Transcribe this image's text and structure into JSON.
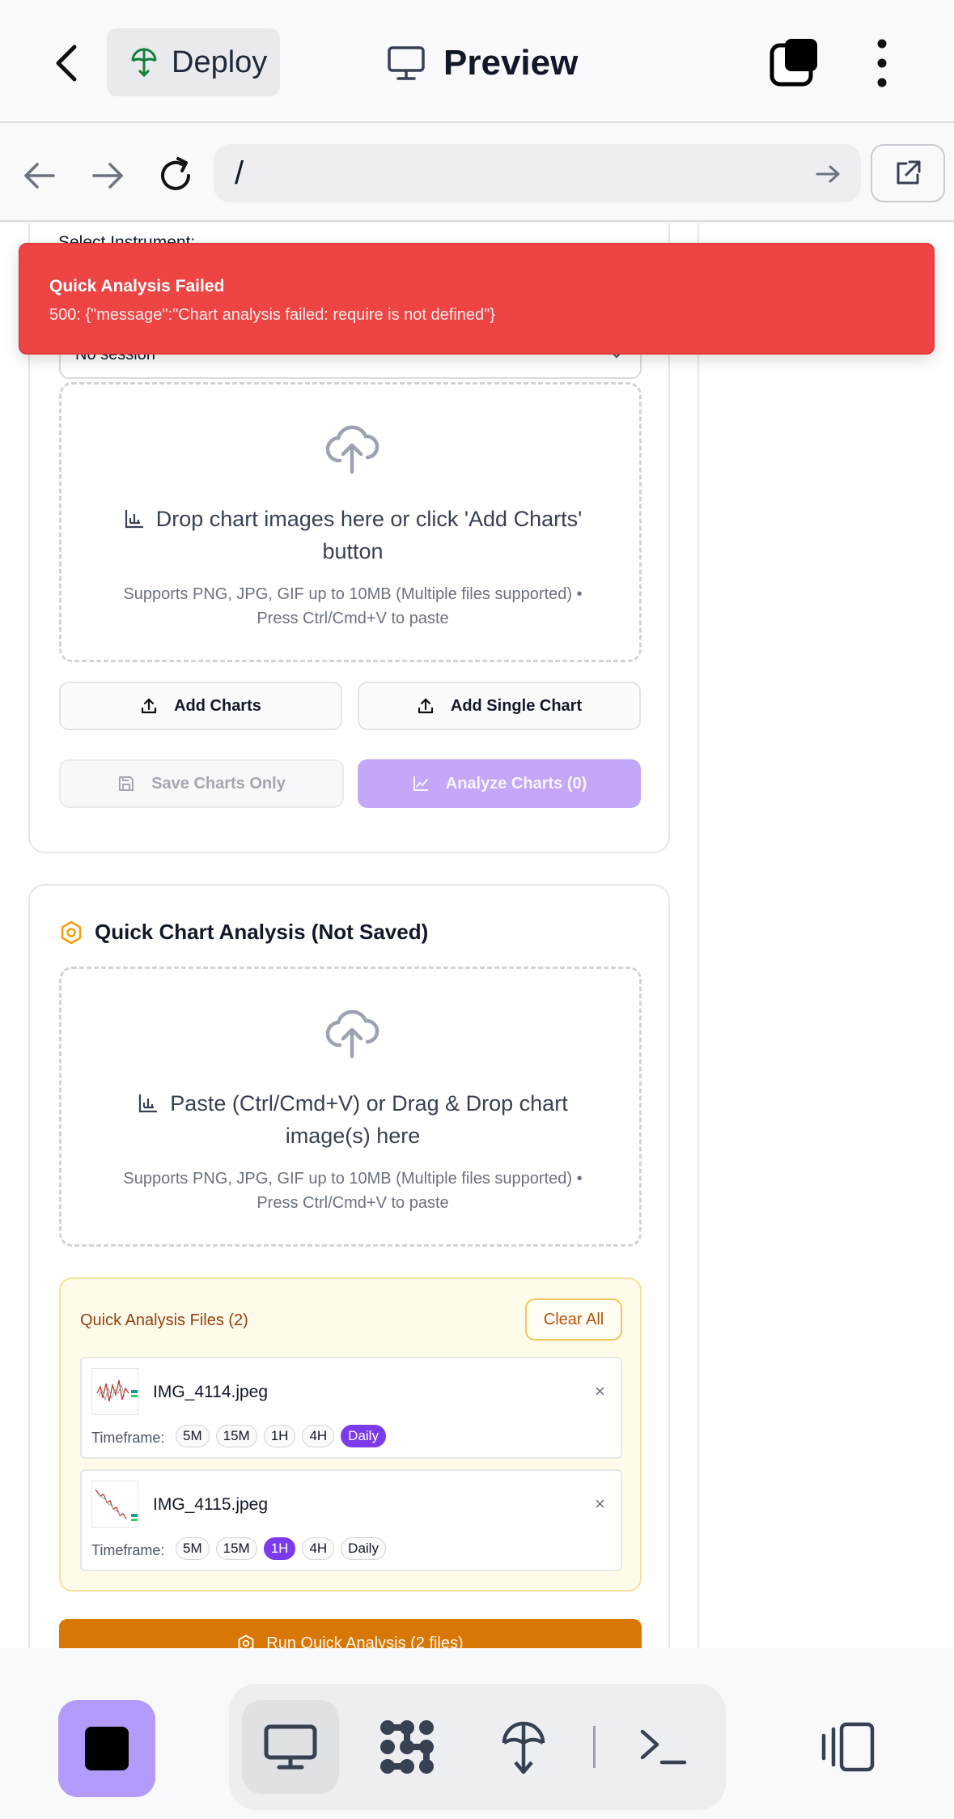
{
  "topbar": {
    "deploy_label": "Deploy",
    "preview_label": "Preview"
  },
  "browser": {
    "url": "/"
  },
  "toast": {
    "title": "Quick Analysis Failed",
    "message": "500: {\"message\":\"Chart analysis failed: require is not defined\"}"
  },
  "upload_card": {
    "instrument_label": "Select Instrument:",
    "session_value": "No session",
    "dropzone_title_line1": "Drop chart images here or click 'Add Charts'",
    "dropzone_title_line2": "button",
    "dropzone_sub_line1": "Supports PNG, JPG, GIF up to 10MB (Multiple files supported) •",
    "dropzone_sub_line2": "Press Ctrl/Cmd+V to paste",
    "add_charts_label": "Add Charts",
    "add_single_label": "Add Single Chart",
    "save_only_label": "Save Charts Only",
    "analyze_label": "Analyze Charts (0)"
  },
  "quick_card": {
    "title": "Quick Chart Analysis (Not Saved)",
    "dropzone_title_line1": "Paste (Ctrl/Cmd+V) or Drag & Drop chart",
    "dropzone_title_line2": "image(s) here",
    "dropzone_sub_line1": "Supports PNG, JPG, GIF up to 10MB (Multiple files supported) •",
    "dropzone_sub_line2": "Press Ctrl/Cmd+V to paste",
    "files_title": "Quick Analysis Files (2)",
    "clear_all_label": "Clear All",
    "timeframe_label": "Timeframe:",
    "files": [
      {
        "name": "IMG_4114.jpeg",
        "close": "×",
        "timeframes": [
          "5M",
          "15M",
          "1H",
          "4H",
          "Daily"
        ],
        "selected": "Daily"
      },
      {
        "name": "IMG_4115.jpeg",
        "close": "×",
        "timeframes": [
          "5M",
          "15M",
          "1H",
          "4H",
          "Daily"
        ],
        "selected": "1H"
      }
    ],
    "run_label": "Run Quick Analysis (2 files)"
  },
  "colors": {
    "accent_purple": "#7c3aed",
    "toast_red": "#ef4444",
    "run_orange": "#d97706",
    "analyze_disabled": "#c4a7f8"
  },
  "icons": {
    "top": [
      "back-arrow-icon",
      "deploy-icon",
      "monitor-icon",
      "tabs-icon",
      "more-vertical-icon"
    ],
    "browser": [
      "arrow-left-icon",
      "arrow-right-icon",
      "reload-icon",
      "go-arrow-icon",
      "external-link-icon"
    ],
    "bottom": [
      "stop-icon",
      "desktop-icon",
      "integrations-icon",
      "deploy-icon",
      "terminal-icon",
      "panel-icon"
    ]
  }
}
